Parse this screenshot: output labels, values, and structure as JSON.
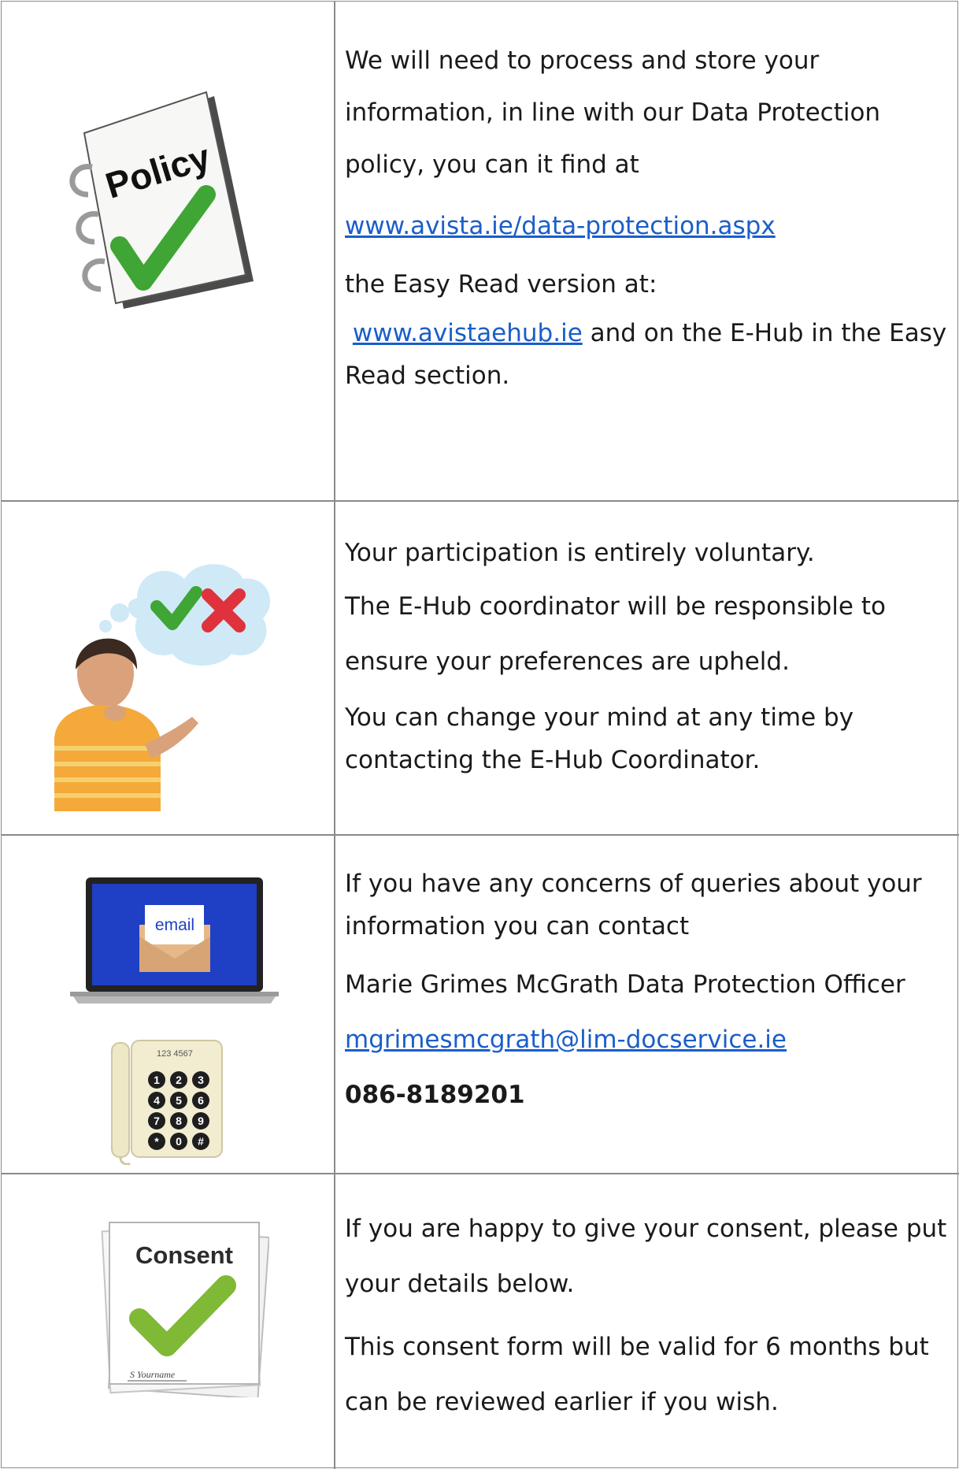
{
  "sections": {
    "policy": {
      "icon_name": "policy-notebook-icon",
      "icon_text": "Policy",
      "line1": "We will need to process and store your",
      "line2": "information, in line with our Data Protection",
      "line3": "policy, you can it find at",
      "link1": "www.avista.ie/data-protection.aspx",
      "line4": "the Easy Read version at:",
      "link2": "www.avistaehub.ie",
      "line5_rest": " and on the E-Hub in the Easy",
      "line6": "Read section."
    },
    "voluntary": {
      "icon_name": "thinking-person-icon",
      "line1": "Your participation is entirely voluntary.",
      "line2": "The E-Hub coordinator will be responsible to",
      "line3": "ensure your preferences are upheld.",
      "line4": "You can change your mind at any time by",
      "line5": "contacting the E-Hub Coordinator."
    },
    "contact": {
      "icon_name": "email-laptop-icon",
      "email_icon_text": "email",
      "phone_icon_name": "telephone-icon",
      "phone_icon_text": "123 4567",
      "keypad": [
        "1",
        "2",
        "3",
        "4",
        "5",
        "6",
        "7",
        "8",
        "9",
        "*",
        "0",
        "#"
      ],
      "line1": "If you have any concerns of queries about your",
      "line2": "information you can contact",
      "line3": "Marie Grimes McGrath Data Protection Officer",
      "email": "mgrimesmcgrath@lim-docservice.ie",
      "phone": "086-8189201"
    },
    "consent": {
      "icon_name": "consent-form-icon",
      "icon_text": "Consent",
      "signature": "S Yourname",
      "line1": "If you are happy to give your consent, please put",
      "line2": "your details below.",
      "line3": "This consent form will be valid for 6 months but",
      "line4": "can be reviewed earlier if you wish."
    }
  },
  "colors": {
    "link": "#1a5ec9",
    "border": "#8a8a8a",
    "check_green": "#3fa535",
    "cross_red": "#e0323c"
  }
}
